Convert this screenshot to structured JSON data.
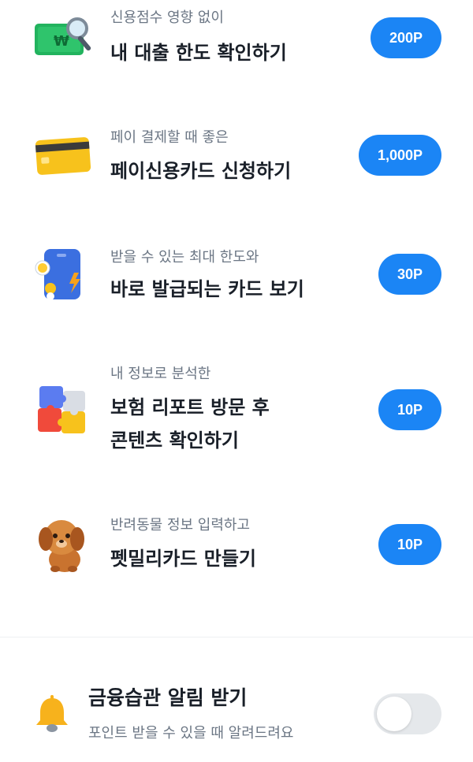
{
  "missions": [
    {
      "subtitle": "신용점수 영향 없이",
      "title": [
        "내 대출 한도 확인하기"
      ],
      "reward": "200P",
      "icon": "money-magnifier-icon"
    },
    {
      "subtitle": "페이 결제할 때 좋은",
      "title": [
        "페이신용카드 신청하기"
      ],
      "reward": "1,000P",
      "icon": "credit-card-icon"
    },
    {
      "subtitle": "받을 수 있는 최대 한도와",
      "title": [
        "바로 발급되는 카드 보기"
      ],
      "reward": "30P",
      "icon": "phone-card-icon"
    },
    {
      "subtitle": "내 정보로 분석한",
      "title": [
        "보험 리포트 방문 후",
        "콘텐츠 확인하기"
      ],
      "reward": "10P",
      "icon": "puzzle-icon"
    },
    {
      "subtitle": "반려동물 정보 입력하고",
      "title": [
        "펫밀리카드 만들기"
      ],
      "reward": "10P",
      "icon": "puppy-icon"
    }
  ],
  "notification": {
    "title": "금융습관 알림 받기",
    "subtitle": "포인트 받을 수 있을 때 알려드려요",
    "enabled": false,
    "icon": "bell-icon"
  },
  "colors": {
    "accent": "#1b85f5",
    "toggle_off": "#e5e8eb"
  }
}
